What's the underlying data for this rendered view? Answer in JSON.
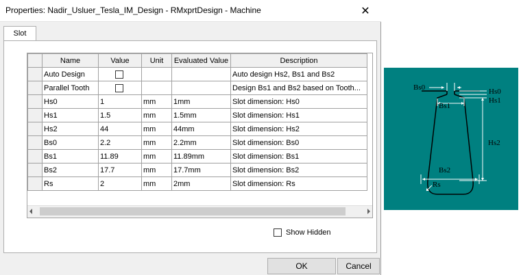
{
  "window": {
    "title": "Properties: Nadir_Usluer_Tesla_IM_Design - RMxprtDesign - Machine",
    "close_glyph": "✕"
  },
  "tabs": [
    {
      "label": "Slot"
    }
  ],
  "grid": {
    "columns": [
      "Name",
      "Value",
      "Unit",
      "Evaluated Value",
      "Description"
    ],
    "rows": [
      {
        "name": "Auto Design",
        "value": "",
        "checkbox": true,
        "unit": "",
        "evaluated": "",
        "description": "Auto design Hs2, Bs1 and Bs2"
      },
      {
        "name": "Parallel Tooth",
        "value": "",
        "checkbox": true,
        "unit": "",
        "evaluated": "",
        "description": "Design Bs1 and Bs2 based on Tooth..."
      },
      {
        "name": "Hs0",
        "value": "1",
        "unit": "mm",
        "evaluated": "1mm",
        "description": "Slot dimension: Hs0"
      },
      {
        "name": "Hs1",
        "value": "1.5",
        "unit": "mm",
        "evaluated": "1.5mm",
        "description": "Slot dimension: Hs1"
      },
      {
        "name": "Hs2",
        "value": "44",
        "unit": "mm",
        "evaluated": "44mm",
        "description": "Slot dimension: Hs2"
      },
      {
        "name": "Bs0",
        "value": "2.2",
        "unit": "mm",
        "evaluated": "2.2mm",
        "description": "Slot dimension: Bs0"
      },
      {
        "name": "Bs1",
        "value": "11.89",
        "unit": "mm",
        "evaluated": "11.89mm",
        "description": "Slot dimension: Bs1"
      },
      {
        "name": "Bs2",
        "value": "17.7",
        "unit": "mm",
        "evaluated": "17.7mm",
        "description": "Slot dimension: Bs2"
      },
      {
        "name": "Rs",
        "value": "2",
        "unit": "mm",
        "evaluated": "2mm",
        "description": "Slot dimension: Rs"
      }
    ]
  },
  "options": {
    "show_hidden_label": "Show Hidden"
  },
  "buttons": {
    "ok": "OK",
    "cancel": "Cancel"
  },
  "diagram": {
    "background": "#008080",
    "labels": {
      "bs0": "Bs0",
      "hs0": "Hs0",
      "hs1": "Hs1",
      "bs1": "Bs1",
      "hs2": "Hs2",
      "bs2": "Bs2",
      "rs": "Rs"
    }
  }
}
